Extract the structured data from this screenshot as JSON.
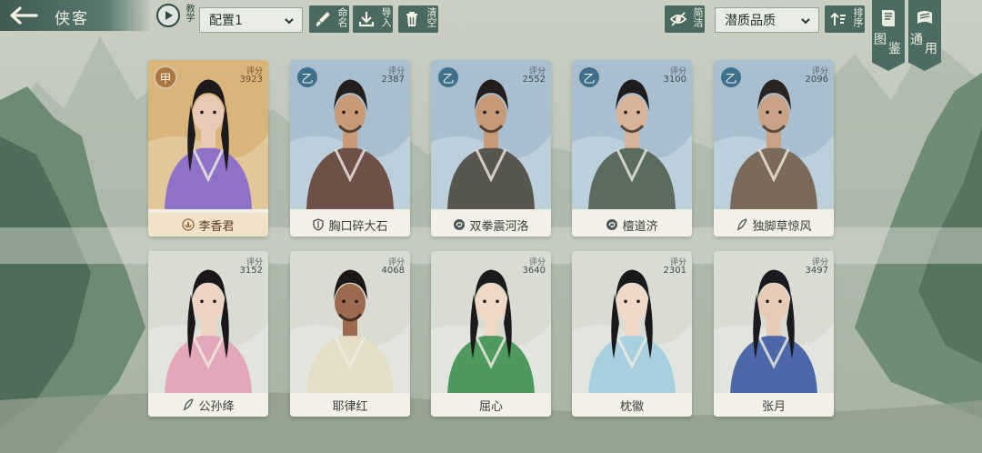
{
  "header": {
    "title": "侠客",
    "tutorial_label": "教学",
    "preset_select": "配置1",
    "rename_label": "命名",
    "import_label": "导入",
    "clear_label": "清空",
    "simple_label": "简洁",
    "sort_select": "潜质品质",
    "sort_label": "排序",
    "side_buttons": [
      {
        "label_a": "图",
        "label_b": "鉴"
      },
      {
        "label_a": "通",
        "label_b": "用"
      }
    ]
  },
  "cards": [
    {
      "name": "李香君",
      "grade": "甲",
      "score_label": "评分",
      "score": "3923",
      "name_icon": "lotus-icon",
      "theme": "gold",
      "skin": "#e9c9b3",
      "robe": "#8e72c8",
      "bg": "#d9b57a",
      "hair": "#1d1a1d"
    },
    {
      "name": "胸口碎大石",
      "grade": "乙",
      "score_label": "评分",
      "score": "2387",
      "name_icon": "shield-icon",
      "theme": "blue",
      "skin": "#c89a76",
      "robe": "#6d5148",
      "bg": "#a9bfd0",
      "hair": "#231d1b"
    },
    {
      "name": "双拳震河洛",
      "grade": "乙",
      "score_label": "评分",
      "score": "2552",
      "name_icon": "swirl-icon",
      "theme": "blue",
      "skin": "#c79a77",
      "robe": "#58574f",
      "bg": "#a9bfd0",
      "hair": "#231e1c"
    },
    {
      "name": "檀道济",
      "grade": "乙",
      "score_label": "评分",
      "score": "3100",
      "name_icon": "swirl-icon",
      "theme": "blue",
      "skin": "#d9b398",
      "robe": "#5a6c5e",
      "bg": "#a9bfd0",
      "hair": "#1e1c1c"
    },
    {
      "name": "独脚草惊风",
      "grade": "乙",
      "score_label": "评分",
      "score": "2096",
      "name_icon": "feather-icon",
      "theme": "blue",
      "skin": "#c9a285",
      "robe": "#7a6a5c",
      "bg": "#a9bfd0",
      "hair": "#2a2420"
    },
    {
      "name": "公孙绛",
      "grade": "",
      "score_label": "评分",
      "score": "3152",
      "name_icon": "feather-icon",
      "theme": "plain",
      "skin": "#efd3c2",
      "robe": "#e2a7b8",
      "bg": "#d9dcd2",
      "hair": "#1b1718"
    },
    {
      "name": "耶律红",
      "grade": "",
      "score_label": "评分",
      "score": "4068",
      "name_icon": "",
      "theme": "plain",
      "skin": "#9c6a4c",
      "robe": "#e6ddc9",
      "bg": "#d9dcd2",
      "hair": "#1d1716"
    },
    {
      "name": "屈心",
      "grade": "",
      "score_label": "评分",
      "score": "3640",
      "name_icon": "",
      "theme": "plain",
      "skin": "#efd7c6",
      "robe": "#4e9a5e",
      "bg": "#d9dcd2",
      "hair": "#1c1a1b"
    },
    {
      "name": "枕徽",
      "grade": "",
      "score_label": "评分",
      "score": "2301",
      "name_icon": "",
      "theme": "plain",
      "skin": "#f0d8c8",
      "robe": "#a7d0de",
      "bg": "#d9dcd2",
      "hair": "#1a1819"
    },
    {
      "name": "张月",
      "grade": "",
      "score_label": "评分",
      "score": "3497",
      "name_icon": "",
      "theme": "plain",
      "skin": "#e8cbb6",
      "robe": "#4d68a8",
      "bg": "#d9dcd2",
      "hair": "#1b1a1f"
    }
  ]
}
